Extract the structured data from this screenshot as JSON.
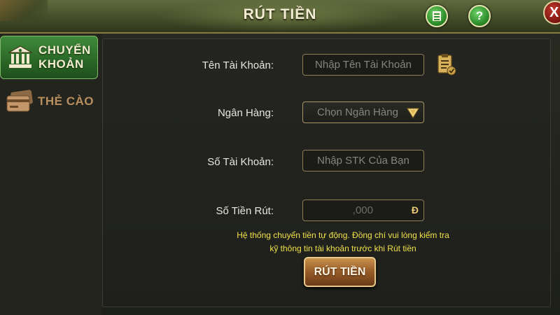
{
  "header": {
    "title": "RÚT TIỀN",
    "list_icon": "document-list-icon",
    "help_label": "?",
    "close_label": "X"
  },
  "sidebar": {
    "items": [
      {
        "label": "CHUYỂN\nKHOẢN",
        "icon": "bank-icon",
        "active": true
      },
      {
        "label": "THẺ CÀO",
        "icon": "card-icon",
        "active": false
      }
    ]
  },
  "form": {
    "account_name": {
      "label": "Tên Tài Khoản:",
      "placeholder": "Nhập Tên Tài Khoản"
    },
    "bank": {
      "label": "Ngân Hàng:",
      "value": "Chọn Ngân Hàng"
    },
    "account_number": {
      "label": "Số Tài Khoản:",
      "placeholder": "Nhập STK Của Bạn"
    },
    "amount": {
      "label": "Số Tiền Rút:",
      "placeholder": ",000",
      "currency": "Đ"
    }
  },
  "notice": {
    "line1": "Hệ thống chuyển tiền tự động. Đồng chí vui lòng kiểm tra",
    "line2": "kỹ thông tin tài khoản trước khi Rút tiền"
  },
  "submit_label": "RÚT TIỀN",
  "colors": {
    "header": "#48532d",
    "active_tab": "#2c6a28",
    "notice": "#f1e24a",
    "button": "#9b5f2a"
  }
}
